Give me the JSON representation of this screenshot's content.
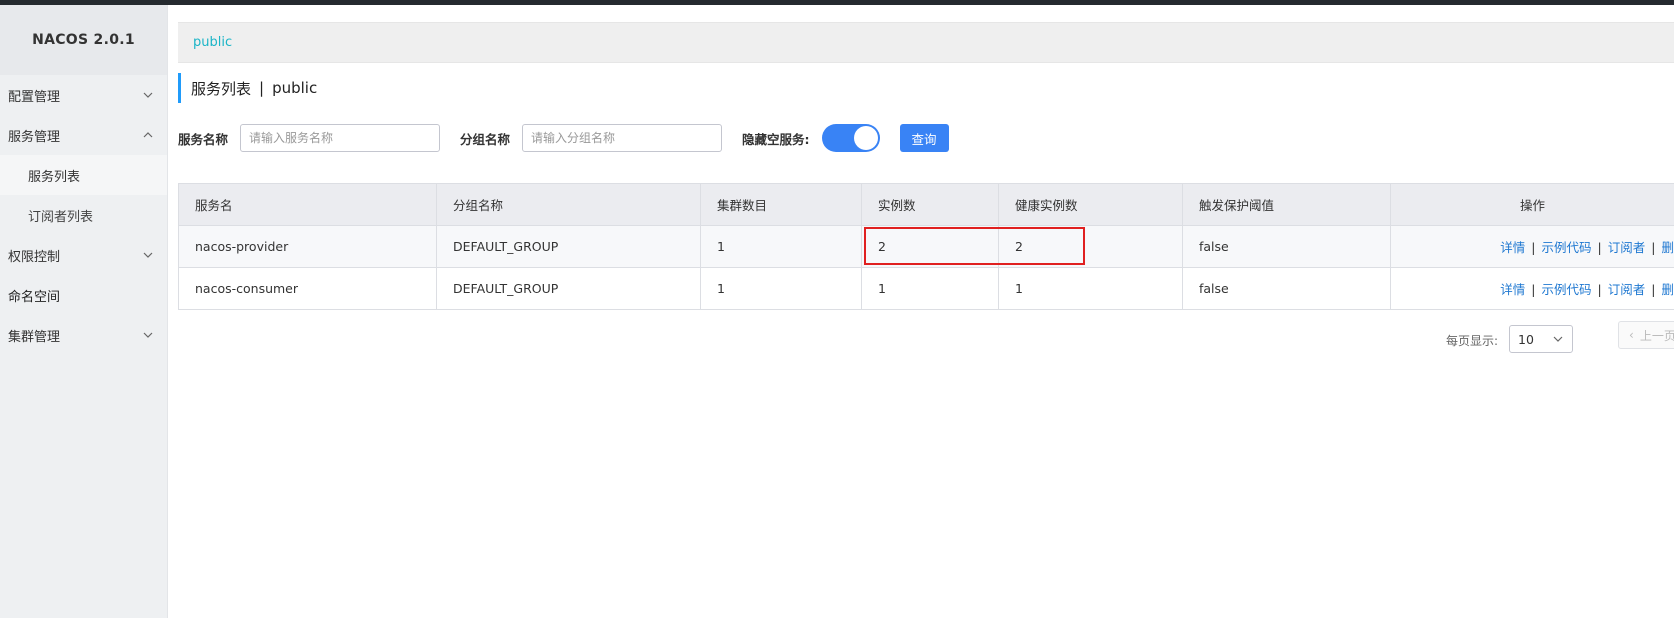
{
  "app": {
    "title": "NACOS 2.0.1"
  },
  "sidebar": {
    "items": [
      {
        "label": "配置管理",
        "expanded": false
      },
      {
        "label": "服务管理",
        "expanded": true,
        "children": [
          {
            "label": "服务列表",
            "active": true
          },
          {
            "label": "订阅者列表",
            "active": false
          }
        ]
      },
      {
        "label": "权限控制",
        "expanded": false
      },
      {
        "label": "命名空间"
      },
      {
        "label": "集群管理",
        "expanded": false
      }
    ]
  },
  "namespace_bar": {
    "current": "public"
  },
  "page": {
    "title": "服务列表",
    "separator": "|",
    "namespace": "public"
  },
  "filters": {
    "service_name_label": "服务名称",
    "service_name_placeholder": "请输入服务名称",
    "group_name_label": "分组名称",
    "group_name_placeholder": "请输入分组名称",
    "hide_empty_label": "隐藏空服务:",
    "hide_empty_on": true,
    "query_label": "查询"
  },
  "table": {
    "columns": [
      "服务名",
      "分组名称",
      "集群数目",
      "实例数",
      "健康实例数",
      "触发保护阈值",
      "操作"
    ],
    "rows": [
      {
        "service": "nacos-provider",
        "group": "DEFAULT_GROUP",
        "clusters": "1",
        "instances": "2",
        "healthy": "2",
        "threshold": "false"
      },
      {
        "service": "nacos-consumer",
        "group": "DEFAULT_GROUP",
        "clusters": "1",
        "instances": "1",
        "healthy": "1",
        "threshold": "false"
      }
    ],
    "actions": {
      "detail": "详情",
      "sample_code": "示例代码",
      "subscriber": "订阅者",
      "delete": "删",
      "sep": "|"
    }
  },
  "pagination": {
    "per_page_label": "每页显示:",
    "per_page": "10",
    "prev_label": "上一页"
  },
  "colors": {
    "accent": "#3983f5",
    "link": "#1f78d1",
    "namespace_link": "#1bb5c7",
    "highlight": "#e02020"
  }
}
